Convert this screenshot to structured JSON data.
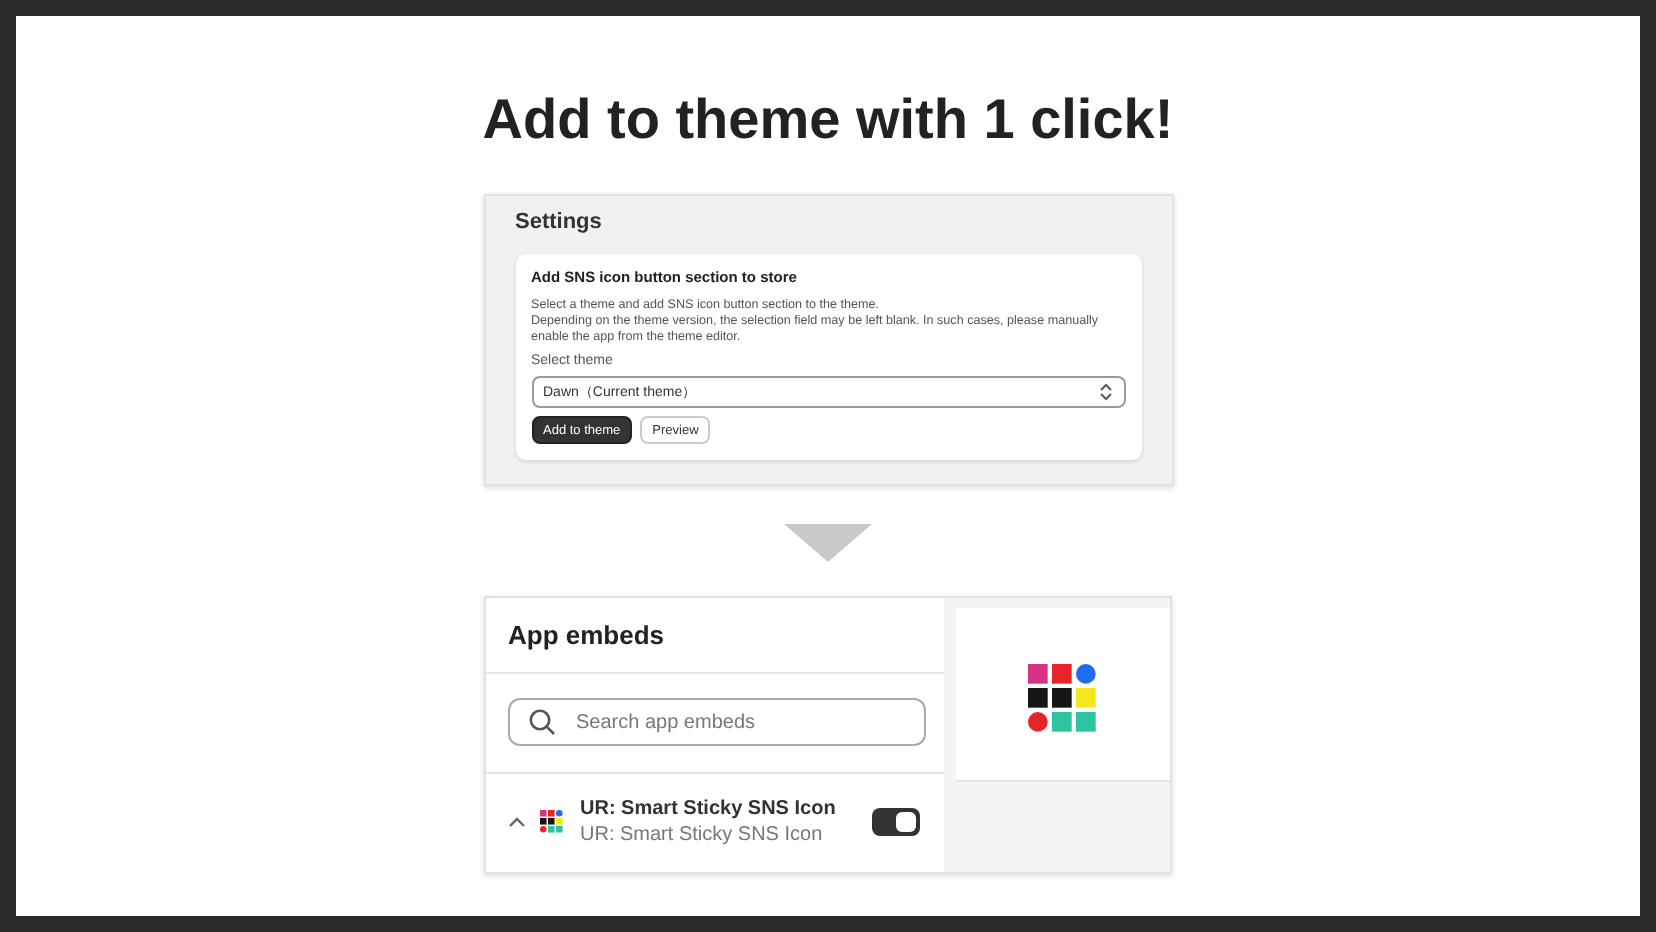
{
  "headline": "Add to theme with 1 click!",
  "settings": {
    "title": "Settings",
    "card_title": "Add SNS icon button section to store",
    "description": [
      "Select a theme and add SNS icon button section to the theme.",
      "Depending on the theme version, the selection field may be left blank. In such cases, please manually enable the app from the theme editor."
    ],
    "select_label": "Select theme",
    "select_value": "Dawn（Current theme）",
    "buttons": [
      {
        "label": "Add to theme",
        "kind": "primary"
      },
      {
        "label": "Preview",
        "kind": "secondary"
      }
    ]
  },
  "app_embeds": {
    "title": "App embeds",
    "search": {
      "placeholder": "Search app embeds"
    },
    "items": [
      {
        "name": "UR: Smart Sticky SNS Icon",
        "subtitle": "UR: Smart Sticky SNS Icon",
        "expanded": true,
        "on": true
      }
    ]
  }
}
